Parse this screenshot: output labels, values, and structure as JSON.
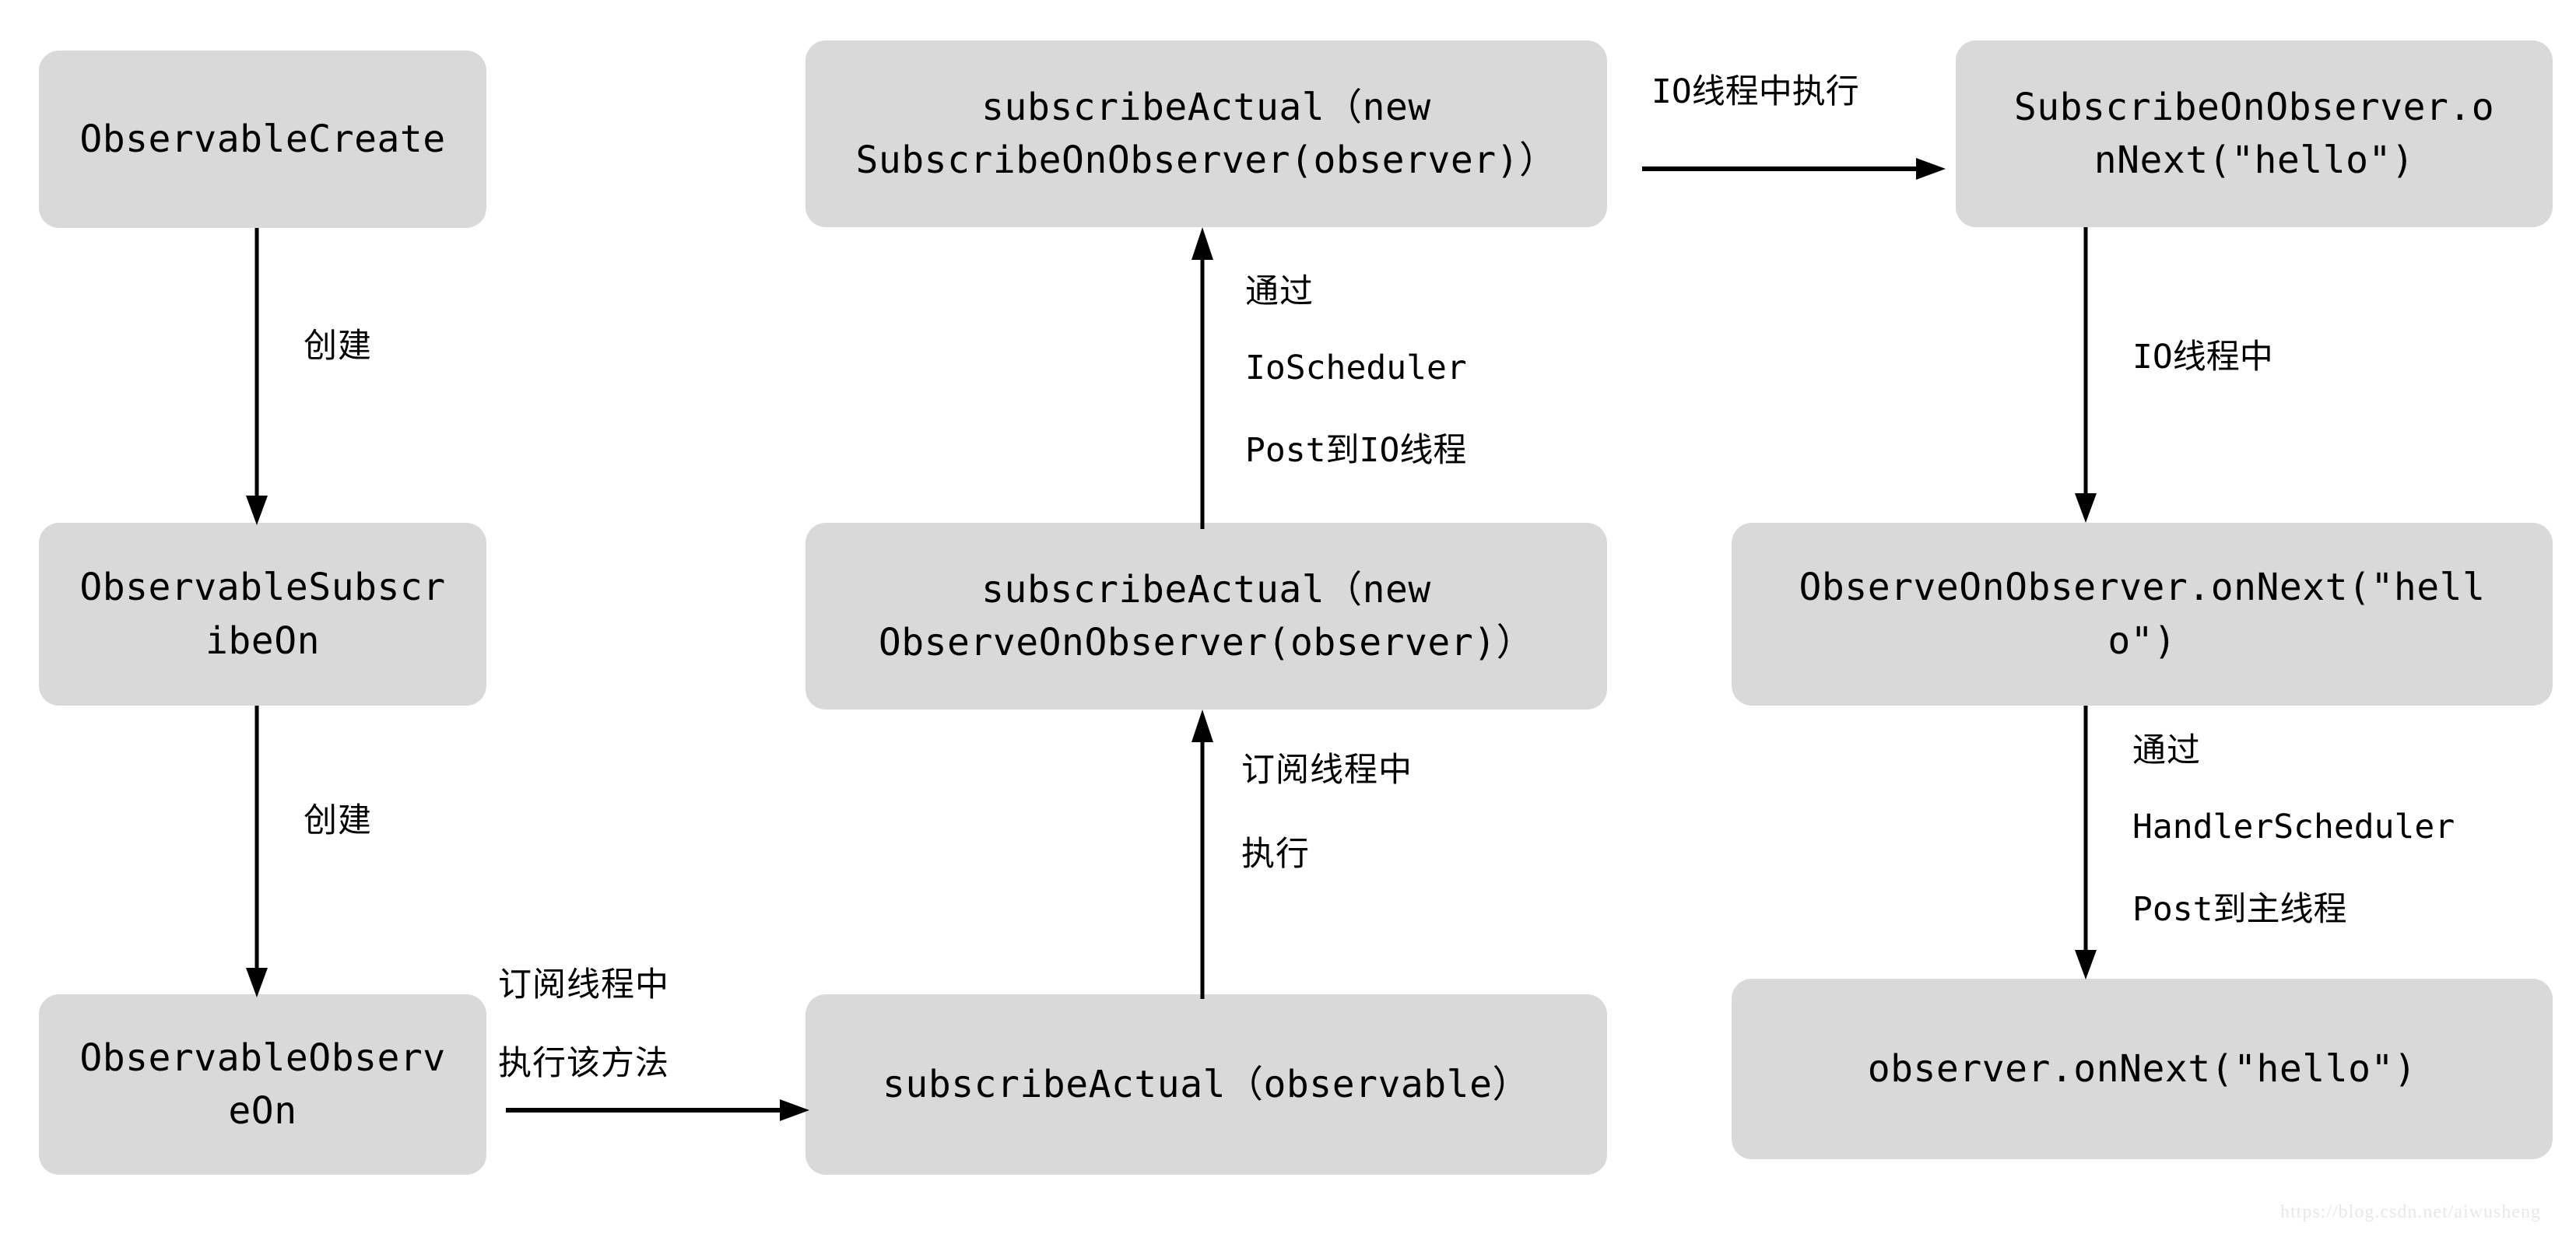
{
  "diagram": {
    "title": "RxJava subscribeOn / observeOn thread switching flow",
    "box_fill": "#d9d9d9",
    "text_color": "#000000",
    "background": "#ffffff"
  },
  "nodes": {
    "observable_create": "ObservableCreate",
    "observable_subscribe_on": "ObservableSubscr\nibeOn",
    "observable_observe_on": "ObservableObserv\neOn",
    "subscribe_actual_subscribeon": "subscribeActual（new\nSubscribeOnObserver(observer)）",
    "subscribe_actual_observeon": "subscribeActual（new\nObserveOnObserver(observer)）",
    "subscribe_actual_observable": "subscribeActual（observable）",
    "subscribeon_observer_onnext": "SubscribeOnObserver.o\nnNext(\"hello\")",
    "observeon_observer_onnext": "ObserveOnObserver.onNext(\"hell\no\")",
    "observer_onnext": "observer.onNext(\"hello\")"
  },
  "edges": {
    "create_1": "创建",
    "create_2": "创建",
    "io_thread_exec": "IO线程中执行",
    "io_thread": "IO线程中",
    "subscribe_thread_exec_method": "订阅线程中\n执行该方法",
    "through_io": {
      "line1": "通过",
      "line2": "IoScheduler",
      "line3": "Post到IO线程"
    },
    "subscribe_thread_exec": {
      "line1": "订阅线程中",
      "line2": "执行"
    },
    "through_handler": {
      "line1": "通过",
      "line2": "HandlerScheduler",
      "line3": "Post到主线程"
    }
  },
  "watermark": "https://blog.csdn.net/aiwusheng"
}
